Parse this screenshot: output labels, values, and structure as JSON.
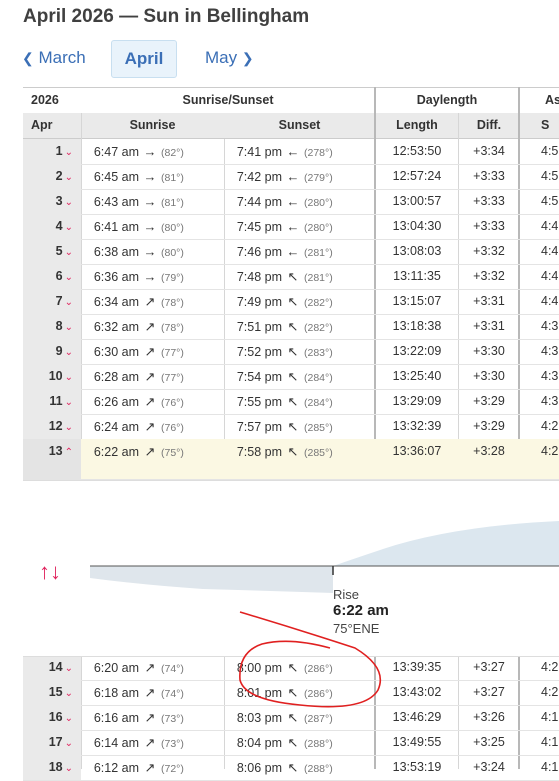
{
  "page": {
    "title": "April 2026 — Sun in Bellingham"
  },
  "nav": {
    "prev": "March",
    "current": "April",
    "next": "May"
  },
  "header": {
    "year": "2026",
    "group_riseset": "Sunrise/Sunset",
    "group_daylength": "Daylength",
    "group_astro": "As",
    "col_month": "Apr",
    "col_sunrise": "Sunrise",
    "col_sunset": "Sunset",
    "col_length": "Length",
    "col_diff": "Diff.",
    "col_astro": "S"
  },
  "rows_top": [
    {
      "day": "1",
      "rise": "6:47 am",
      "rise_deg": "(82°)",
      "set": "7:41 pm",
      "set_deg": "(278°)",
      "len": "12:53:50",
      "diff": "+3:34",
      "ast": "4:5",
      "rise_arrow": "→",
      "set_arrow": "←"
    },
    {
      "day": "2",
      "rise": "6:45 am",
      "rise_deg": "(81°)",
      "set": "7:42 pm",
      "set_deg": "(279°)",
      "len": "12:57:24",
      "diff": "+3:33",
      "ast": "4:5",
      "rise_arrow": "→",
      "set_arrow": "←"
    },
    {
      "day": "3",
      "rise": "6:43 am",
      "rise_deg": "(81°)",
      "set": "7:44 pm",
      "set_deg": "(280°)",
      "len": "13:00:57",
      "diff": "+3:33",
      "ast": "4:5",
      "rise_arrow": "→",
      "set_arrow": "←"
    },
    {
      "day": "4",
      "rise": "6:41 am",
      "rise_deg": "(80°)",
      "set": "7:45 pm",
      "set_deg": "(280°)",
      "len": "13:04:30",
      "diff": "+3:33",
      "ast": "4:4",
      "rise_arrow": "→",
      "set_arrow": "←"
    },
    {
      "day": "5",
      "rise": "6:38 am",
      "rise_deg": "(80°)",
      "set": "7:46 pm",
      "set_deg": "(281°)",
      "len": "13:08:03",
      "diff": "+3:32",
      "ast": "4:4",
      "rise_arrow": "→",
      "set_arrow": "←"
    },
    {
      "day": "6",
      "rise": "6:36 am",
      "rise_deg": "(79°)",
      "set": "7:48 pm",
      "set_deg": "(281°)",
      "len": "13:11:35",
      "diff": "+3:32",
      "ast": "4:4",
      "rise_arrow": "→",
      "set_arrow": "↖"
    },
    {
      "day": "7",
      "rise": "6:34 am",
      "rise_deg": "(78°)",
      "set": "7:49 pm",
      "set_deg": "(282°)",
      "len": "13:15:07",
      "diff": "+3:31",
      "ast": "4:4",
      "rise_arrow": "↗",
      "set_arrow": "↖"
    },
    {
      "day": "8",
      "rise": "6:32 am",
      "rise_deg": "(78°)",
      "set": "7:51 pm",
      "set_deg": "(282°)",
      "len": "13:18:38",
      "diff": "+3:31",
      "ast": "4:3",
      "rise_arrow": "↗",
      "set_arrow": "↖"
    },
    {
      "day": "9",
      "rise": "6:30 am",
      "rise_deg": "(77°)",
      "set": "7:52 pm",
      "set_deg": "(283°)",
      "len": "13:22:09",
      "diff": "+3:30",
      "ast": "4:3",
      "rise_arrow": "↗",
      "set_arrow": "↖"
    },
    {
      "day": "10",
      "rise": "6:28 am",
      "rise_deg": "(77°)",
      "set": "7:54 pm",
      "set_deg": "(284°)",
      "len": "13:25:40",
      "diff": "+3:30",
      "ast": "4:3",
      "rise_arrow": "↗",
      "set_arrow": "↖"
    },
    {
      "day": "11",
      "rise": "6:26 am",
      "rise_deg": "(76°)",
      "set": "7:55 pm",
      "set_deg": "(284°)",
      "len": "13:29:09",
      "diff": "+3:29",
      "ast": "4:3",
      "rise_arrow": "↗",
      "set_arrow": "↖"
    },
    {
      "day": "12",
      "rise": "6:24 am",
      "rise_deg": "(76°)",
      "set": "7:57 pm",
      "set_deg": "(285°)",
      "len": "13:32:39",
      "diff": "+3:29",
      "ast": "4:2",
      "rise_arrow": "↗",
      "set_arrow": "↖"
    }
  ],
  "selected_row": {
    "day": "13",
    "rise": "6:22 am",
    "rise_deg": "(75°)",
    "set": "7:58 pm",
    "set_deg": "(285°)",
    "len": "13:36:07",
    "diff": "+3:28",
    "ast": "4:2",
    "rise_arrow": "↗",
    "set_arrow": "↖"
  },
  "detail": {
    "rise_label": "Rise",
    "rise_time": "6:22 am",
    "rise_direction": "75°ENE"
  },
  "rows_bottom": [
    {
      "day": "14",
      "rise": "6:20 am",
      "rise_deg": "(74°)",
      "set": "8:00 pm",
      "set_deg": "(286°)",
      "len": "13:39:35",
      "diff": "+3:27",
      "ast": "4:2",
      "rise_arrow": "↗",
      "set_arrow": "↖"
    },
    {
      "day": "15",
      "rise": "6:18 am",
      "rise_deg": "(74°)",
      "set": "8:01 pm",
      "set_deg": "(286°)",
      "len": "13:43:02",
      "diff": "+3:27",
      "ast": "4:2",
      "rise_arrow": "↗",
      "set_arrow": "↖"
    },
    {
      "day": "16",
      "rise": "6:16 am",
      "rise_deg": "(73°)",
      "set": "8:03 pm",
      "set_deg": "(287°)",
      "len": "13:46:29",
      "diff": "+3:26",
      "ast": "4:1",
      "rise_arrow": "↗",
      "set_arrow": "↖"
    },
    {
      "day": "17",
      "rise": "6:14 am",
      "rise_deg": "(73°)",
      "set": "8:04 pm",
      "set_deg": "(288°)",
      "len": "13:49:55",
      "diff": "+3:25",
      "ast": "4:1",
      "rise_arrow": "↗",
      "set_arrow": "↖"
    },
    {
      "day": "18",
      "rise": "6:12 am",
      "rise_deg": "(72°)",
      "set": "8:06 pm",
      "set_deg": "(288°)",
      "len": "13:53:19",
      "diff": "+3:24",
      "ast": "4:1",
      "rise_arrow": "↗",
      "set_arrow": "↖"
    }
  ],
  "colors": {
    "accent": "#3b6fb6",
    "chevron": "#e0245e",
    "selected_bg": "#fbf8e3",
    "annotation": "#e02020"
  },
  "icons": {
    "nav_prev": "chevron-left-icon",
    "nav_next": "chevron-right-icon",
    "expand": "chevron-down-icon",
    "collapse": "chevron-up-icon",
    "rise_set": "up-down-arrows-icon"
  }
}
